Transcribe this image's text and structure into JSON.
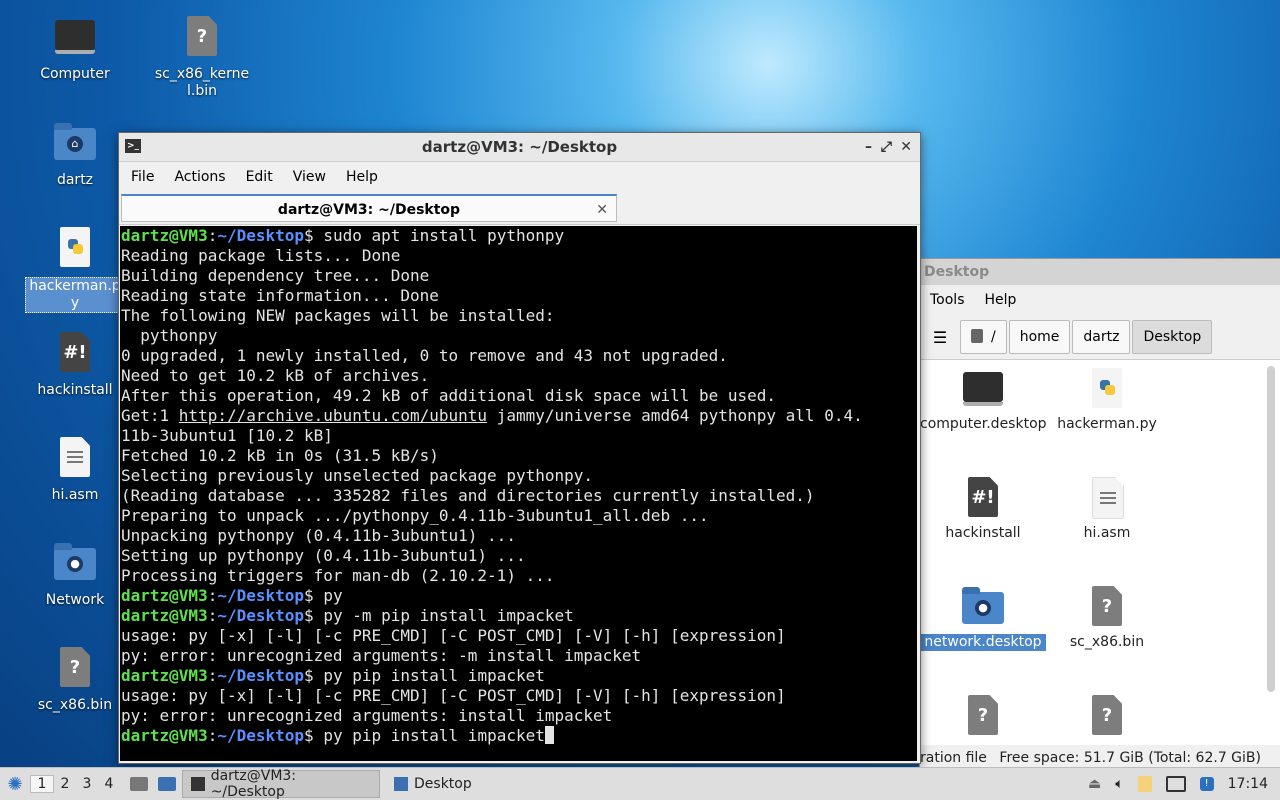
{
  "desktop": {
    "icons": [
      {
        "label": "Computer"
      },
      {
        "label": "sc_x86_kernel.bin"
      },
      {
        "label": "dartz"
      },
      {
        "label": "hackerman.py"
      },
      {
        "label": "hackinstall"
      },
      {
        "label": "hi.asm"
      },
      {
        "label": "Network"
      },
      {
        "label": "sc_x86.bin"
      }
    ]
  },
  "file_manager": {
    "title": "Desktop",
    "menu": [
      "Tools",
      "Help"
    ],
    "path": [
      "/",
      "home",
      "dartz",
      "Desktop"
    ],
    "items": [
      {
        "label": "computer.desktop"
      },
      {
        "label": "hackerman.py"
      },
      {
        "label": "hackinstall"
      },
      {
        "label": "hi.asm"
      },
      {
        "label": "network.desktop"
      },
      {
        "label": "sc_x86.bin"
      }
    ],
    "status_left": "ration file",
    "status_right": "Free space: 51.7 GiB (Total: 62.7 GiB)"
  },
  "terminal": {
    "title": "dartz@VM3: ~/Desktop",
    "menu": [
      "File",
      "Actions",
      "Edit",
      "View",
      "Help"
    ],
    "tab_label": "dartz@VM3: ~/Desktop",
    "prompt_user": "dartz@VM3",
    "prompt_path": "~/Desktop",
    "lines": [
      {
        "cmd": "sudo apt install pythonpy"
      },
      {
        "out": "Reading package lists... Done"
      },
      {
        "out": "Building dependency tree... Done"
      },
      {
        "out": "Reading state information... Done"
      },
      {
        "out": "The following NEW packages will be installed:"
      },
      {
        "out": "  pythonpy"
      },
      {
        "out": "0 upgraded, 1 newly installed, 0 to remove and 43 not upgraded."
      },
      {
        "out": "Need to get 10.2 kB of archives."
      },
      {
        "out": "After this operation, 49.2 kB of additional disk space will be used."
      },
      {
        "link_pre": "Get:1 ",
        "link": "http://archive.ubuntu.com/ubuntu",
        "link_post": " jammy/universe amd64 pythonpy all 0.4."
      },
      {
        "out": "11b-3ubuntu1 [10.2 kB]"
      },
      {
        "out": "Fetched 10.2 kB in 0s (31.5 kB/s)"
      },
      {
        "out": "Selecting previously unselected package pythonpy."
      },
      {
        "out": "(Reading database ... 335282 files and directories currently installed.)"
      },
      {
        "out": "Preparing to unpack .../pythonpy_0.4.11b-3ubuntu1_all.deb ..."
      },
      {
        "out": "Unpacking pythonpy (0.4.11b-3ubuntu1) ..."
      },
      {
        "out": "Setting up pythonpy (0.4.11b-3ubuntu1) ..."
      },
      {
        "out": "Processing triggers for man-db (2.10.2-1) ..."
      },
      {
        "cmd": "py"
      },
      {
        "cmd": "py -m pip install impacket"
      },
      {
        "out": "usage: py [-x] [-l] [-c PRE_CMD] [-C POST_CMD] [-V] [-h] [expression]"
      },
      {
        "out": "py: error: unrecognized arguments: -m install impacket"
      },
      {
        "cmd": "py pip install impacket"
      },
      {
        "out": "usage: py [-x] [-l] [-c PRE_CMD] [-C POST_CMD] [-V] [-h] [expression]"
      },
      {
        "out": "py: error: unrecognized arguments: install impacket"
      },
      {
        "cmd": "py pip install impacket",
        "cursor": true
      }
    ]
  },
  "taskbar": {
    "workspaces": [
      "1",
      "2",
      "3",
      "4"
    ],
    "tasks": [
      {
        "label": "dartz@VM3: ~/Desktop"
      },
      {
        "label": "Desktop"
      }
    ],
    "clock": "17:14"
  },
  "colors": {
    "prompt_user": "#5de14d",
    "prompt_path": "#5a8fff",
    "selection": "#4a86c8"
  }
}
